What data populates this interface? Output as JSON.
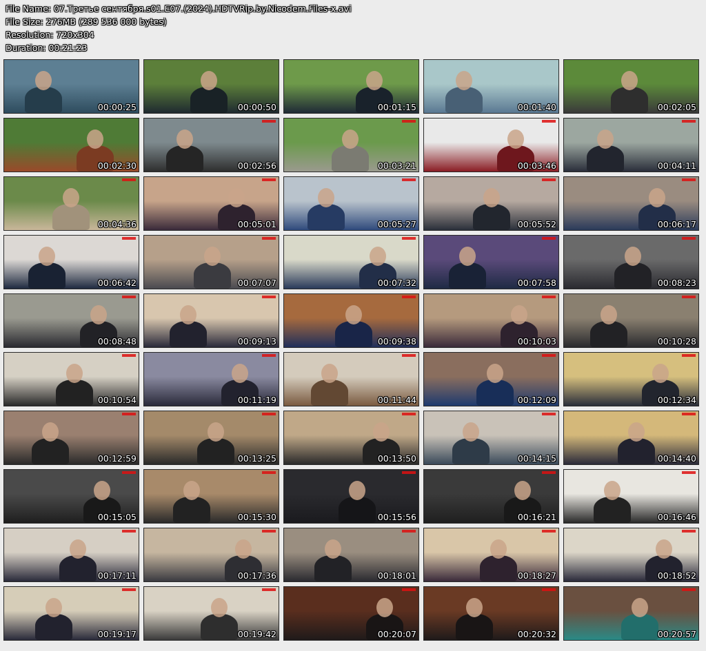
{
  "header": {
    "file_name": "File Name: 07.Третье сентября.s01.E07.(2024).HDTVRip.by.Nicodem.Files-x.avi",
    "file_size": "File Size: 276MB (289 536 000 bytes)",
    "resolution": "Resolution: 720x304",
    "duration": "Duration: 00:21:23"
  },
  "thumbnails": [
    {
      "time": "00:00:25",
      "palette": [
        "#5d7f93",
        "#2e4c5e"
      ]
    },
    {
      "time": "00:00:50",
      "palette": [
        "#5c7f3a",
        "#1f2a30"
      ]
    },
    {
      "time": "00:01:15",
      "palette": [
        "#6e9a4a",
        "#1f2a36"
      ]
    },
    {
      "time": "00:01:40",
      "palette": [
        "#a9c7c9",
        "#5a7892"
      ]
    },
    {
      "time": "00:02:05",
      "palette": [
        "#5c8a3a",
        "#3a3a3a"
      ]
    },
    {
      "time": "00:02:30",
      "palette": [
        "#4f7b36",
        "#9a4a2a"
      ]
    },
    {
      "time": "00:02:56",
      "palette": [
        "#7e8a8e",
        "#2e2e2e"
      ]
    },
    {
      "time": "00:03:21",
      "palette": [
        "#6b9a4c",
        "#9a9a8e"
      ]
    },
    {
      "time": "00:03:46",
      "palette": [
        "#e9e9e9",
        "#8a1d24"
      ]
    },
    {
      "time": "00:04:11",
      "palette": [
        "#9ca7a0",
        "#2a2e3a"
      ]
    },
    {
      "time": "00:04:36",
      "palette": [
        "#6b8a4a",
        "#c9b79a"
      ]
    },
    {
      "time": "00:05:01",
      "palette": [
        "#c7a48a",
        "#3a2a3a"
      ]
    },
    {
      "time": "00:05:27",
      "palette": [
        "#b9c3cc",
        "#2f4a7c"
      ]
    },
    {
      "time": "00:05:52",
      "palette": [
        "#b6a9a0",
        "#2a2f3a"
      ]
    },
    {
      "time": "00:06:17",
      "palette": [
        "#9a8c80",
        "#2a3a5a"
      ]
    },
    {
      "time": "00:06:42",
      "palette": [
        "#dcd8d4",
        "#1f2a40"
      ]
    },
    {
      "time": "00:07:07",
      "palette": [
        "#b6a08a",
        "#4a4a50"
      ]
    },
    {
      "time": "00:07:32",
      "palette": [
        "#d9d9c9",
        "#2a3a5a"
      ]
    },
    {
      "time": "00:07:58",
      "palette": [
        "#5a4a7a",
        "#1f2a44"
      ]
    },
    {
      "time": "00:08:23",
      "palette": [
        "#6a6a6a",
        "#2a2a30"
      ]
    },
    {
      "time": "00:08:48",
      "palette": [
        "#9a9a90",
        "#2a2a30"
      ]
    },
    {
      "time": "00:09:13",
      "palette": [
        "#d8c6ae",
        "#2a2a3a"
      ]
    },
    {
      "time": "00:09:38",
      "palette": [
        "#a66a3e",
        "#1f2e5a"
      ]
    },
    {
      "time": "00:10:03",
      "palette": [
        "#b59a7e",
        "#3a2a3a"
      ]
    },
    {
      "time": "00:10:28",
      "palette": [
        "#8a8070",
        "#2a2a2e"
      ]
    },
    {
      "time": "00:10:54",
      "palette": [
        "#d6d0c4",
        "#2a2a2a"
      ]
    },
    {
      "time": "00:11:19",
      "palette": [
        "#8a8aa0",
        "#2a2a3a"
      ]
    },
    {
      "time": "00:11:44",
      "palette": [
        "#d4cbbc",
        "#7a5a40"
      ]
    },
    {
      "time": "00:12:09",
      "palette": [
        "#8a6e5e",
        "#1e3a6e"
      ]
    },
    {
      "time": "00:12:34",
      "palette": [
        "#d6bf7e",
        "#2a2e3a"
      ]
    },
    {
      "time": "00:12:59",
      "palette": [
        "#9a8070",
        "#2a2a2a"
      ]
    },
    {
      "time": "00:13:25",
      "palette": [
        "#a48a6a",
        "#2a2a2a"
      ]
    },
    {
      "time": "00:13:50",
      "palette": [
        "#c0a888",
        "#2a2a2a"
      ]
    },
    {
      "time": "00:14:15",
      "palette": [
        "#c9c2b8",
        "#3a4a5a"
      ]
    },
    {
      "time": "00:14:40",
      "palette": [
        "#d4b87a",
        "#2a2a3a"
      ]
    },
    {
      "time": "00:15:05",
      "palette": [
        "#4a4a4a",
        "#1f1f1f"
      ]
    },
    {
      "time": "00:15:30",
      "palette": [
        "#a88a6a",
        "#2a2a2a"
      ]
    },
    {
      "time": "00:15:56",
      "palette": [
        "#2a2a2e",
        "#1a1a1e"
      ]
    },
    {
      "time": "00:16:21",
      "palette": [
        "#3a3a3a",
        "#1f1f1f"
      ]
    },
    {
      "time": "00:16:46",
      "palette": [
        "#e8e6e0",
        "#2a2a2a"
      ]
    },
    {
      "time": "00:17:11",
      "palette": [
        "#d6cfc4",
        "#2a2a3a"
      ]
    },
    {
      "time": "00:17:36",
      "palette": [
        "#c6b6a0",
        "#3a3a40"
      ]
    },
    {
      "time": "00:18:01",
      "palette": [
        "#9a8e80",
        "#2a2a30"
      ]
    },
    {
      "time": "00:18:27",
      "palette": [
        "#d9c6a8",
        "#3a2a3a"
      ]
    },
    {
      "time": "00:18:52",
      "palette": [
        "#dcd6c8",
        "#2a2a3a"
      ]
    },
    {
      "time": "00:19:17",
      "palette": [
        "#d6cdb8",
        "#2a2a3a"
      ]
    },
    {
      "time": "00:19:42",
      "palette": [
        "#d9d2c4",
        "#3a3a3a"
      ]
    },
    {
      "time": "00:20:07",
      "palette": [
        "#5a2e1e",
        "#1f1a1a"
      ]
    },
    {
      "time": "00:20:32",
      "palette": [
        "#6a3a24",
        "#1f1a1a"
      ]
    },
    {
      "time": "00:20:57",
      "palette": [
        "#6a5040",
        "#2a8a86"
      ]
    }
  ]
}
